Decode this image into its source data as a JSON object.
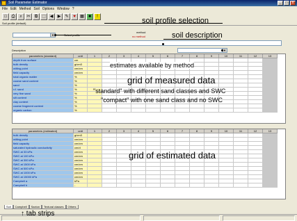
{
  "window": {
    "title": "Soil Parameter Estimator",
    "controls": [
      "_",
      "□",
      "x"
    ]
  },
  "menu": [
    "File",
    "Edit",
    "Method",
    "Soil",
    "Options",
    "Window",
    "?"
  ],
  "toolbar": {
    "buttons": [
      "□",
      "⎙",
      "⌕",
      "✂",
      "⧉",
      "⬚",
      "◀",
      "▶",
      "✎",
      "♥",
      "▦",
      "■",
      "!"
    ],
    "sub_label": "Soil profile  (default)"
  },
  "annotations": {
    "soil_profile_selection": "soil profile selection",
    "soil_description": "soil description",
    "estimates_by_method": "estimates available by method",
    "grid_measured": "grid of measured data",
    "standard_note": "\"standard\" with different sand classes and SWC",
    "compact_note": "\"compact\" with one sand class and no SWC",
    "grid_estimated": "grid of estimated data",
    "tab_strips": "↑ tab strips"
  },
  "profile": {
    "label": "Select profile",
    "method_label": "method",
    "method_value": "no method"
  },
  "measured_grid": {
    "title_left": "Description",
    "header": [
      "parameters (standard)",
      "unit",
      "1",
      "2",
      "3",
      "4",
      "5",
      "6",
      "7",
      "8",
      "9",
      "10",
      "11",
      "12",
      "13"
    ],
    "rows": [
      {
        "name": "depth from surface",
        "unit": "cm"
      },
      {
        "name": "bulk density",
        "unit": "g/cm3"
      },
      {
        "name": "wilting point",
        "unit": "cm/cm"
      },
      {
        "name": "field capacity",
        "unit": "cm/cm"
      },
      {
        "name": "total organic matter",
        "unit": "%"
      },
      {
        "name": "coarse sand content",
        "unit": "%"
      },
      {
        "name": "sand",
        "unit": "%"
      },
      {
        "name": "v.f. sand",
        "unit": "%"
      },
      {
        "name": "very fine sand",
        "unit": "%"
      },
      {
        "name": "silt content",
        "unit": "%"
      },
      {
        "name": "clay content",
        "unit": "%"
      },
      {
        "name": "coarse fragment content",
        "unit": "%"
      },
      {
        "name": "organic carbon",
        "unit": "%"
      }
    ]
  },
  "estimated_grid": {
    "header": [
      "parameters (estimated)",
      "unit",
      "1",
      "2",
      "3",
      "4",
      "5",
      "6",
      "7",
      "8",
      "9",
      "10",
      "11",
      "12",
      "13"
    ],
    "rows": [
      {
        "name": "bulk density",
        "unit": "g/cm3"
      },
      {
        "name": "wilting point",
        "unit": "cm/cm"
      },
      {
        "name": "field capacity",
        "unit": "cm/cm"
      },
      {
        "name": "saturated hydraulic conductivity",
        "unit": "cm/d"
      },
      {
        "name": "SWC at 33 kPa",
        "unit": "cm/cm"
      },
      {
        "name": "SWC at 100 kPa",
        "unit": "cm/cm"
      },
      {
        "name": "SWC at 300 kPa",
        "unit": "cm/cm"
      },
      {
        "name": "SWC at 1500 kPa",
        "unit": "cm/cm"
      },
      {
        "name": "SWC at 500 kPa",
        "unit": "cm/cm"
      },
      {
        "name": "SWC at 1000 kPa",
        "unit": "cm/cm"
      },
      {
        "name": "SWC at 15000 kPa",
        "unit": "cm/cm"
      },
      {
        "name": "Campbell a",
        "unit": "kPa"
      },
      {
        "name": "Campbell b",
        "unit": "-"
      }
    ]
  },
  "tabs": [
    "Soil",
    "Campbell",
    "Saxton",
    "Textural classes",
    "Others"
  ],
  "colors": {
    "name_col": "#9fc7ec",
    "unit_col": "#fff8b8",
    "title_bar": "#0a246a"
  }
}
